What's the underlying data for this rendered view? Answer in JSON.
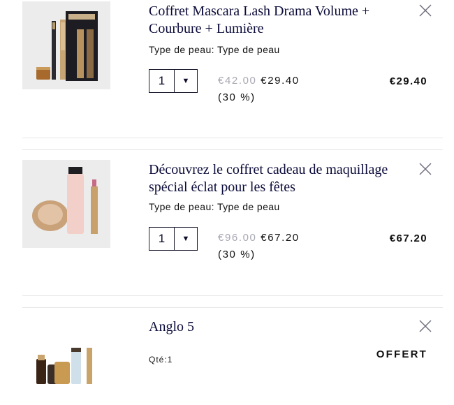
{
  "items": [
    {
      "title": "Coffret Mascara Lash Drama Volume + Courbure + Lumière",
      "skin": "Type de peau: Type de peau",
      "qty": "1",
      "old_price": "€42.00",
      "new_price": "€29.40",
      "discount": "(30 %)",
      "total": "€29.40"
    },
    {
      "title": "Découvrez le coffret cadeau de maquillage spécial éclat pour les fêtes",
      "skin": "Type de peau: Type de peau",
      "qty": "1",
      "old_price": "€96.00",
      "new_price": "€67.20",
      "discount": "(30 %)",
      "total": "€67.20"
    },
    {
      "title": "Anglo 5",
      "qty_label": "Qté:1",
      "status": "OFFERT"
    }
  ],
  "icons": {
    "close": "close-icon",
    "dropdown": "chevron-down-icon"
  }
}
